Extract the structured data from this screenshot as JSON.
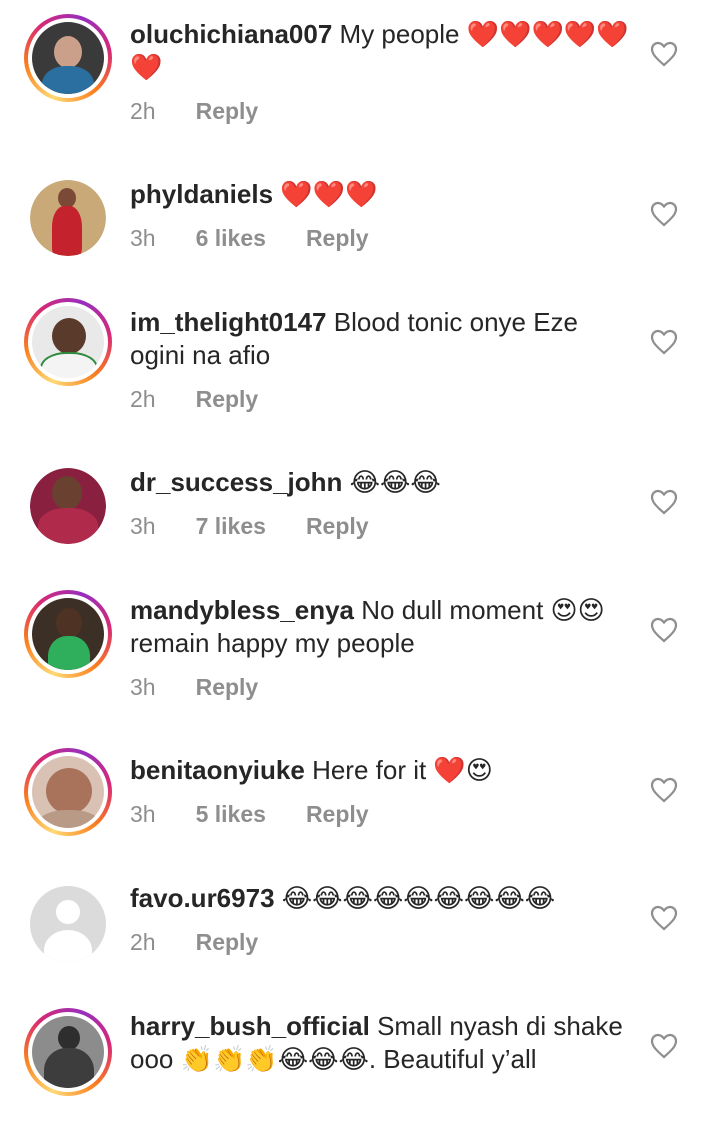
{
  "comments": [
    {
      "username": "oluchichiana007",
      "text": "My people ❤️❤️❤️❤️❤️❤️",
      "time": "2h",
      "likes": "",
      "reply": "Reply"
    },
    {
      "username": "phyldaniels",
      "text": "❤️❤️❤️",
      "time": "3h",
      "likes": "6 likes",
      "reply": "Reply"
    },
    {
      "username": "im_thelight0147",
      "text": "Blood tonic onye Eze ogini na afio",
      "time": "2h",
      "likes": "",
      "reply": "Reply"
    },
    {
      "username": "dr_success_john",
      "text": "😂😂😂",
      "time": "3h",
      "likes": "7 likes",
      "reply": "Reply"
    },
    {
      "username": "mandybless_enya",
      "text": "No dull moment 😍😍 remain happy my people",
      "time": "3h",
      "likes": "",
      "reply": "Reply"
    },
    {
      "username": "benitaonyiuke",
      "text": "Here for it ❤️😍",
      "time": "3h",
      "likes": "5 likes",
      "reply": "Reply"
    },
    {
      "username": "favo.ur6973",
      "text": "😂😂😂😂😂😂😂😂😂",
      "time": "2h",
      "likes": "",
      "reply": "Reply"
    },
    {
      "username": "harry_bush_official",
      "text": "Small nyash di shake ooo 👏👏👏😂😂😂. Beautiful y’all",
      "time": "",
      "likes": "",
      "reply": ""
    }
  ],
  "icons": {
    "like": "heart-outline-icon"
  },
  "colors": {
    "meta": "#8e8e8e",
    "text": "#262626",
    "heart": "#e0182d"
  }
}
